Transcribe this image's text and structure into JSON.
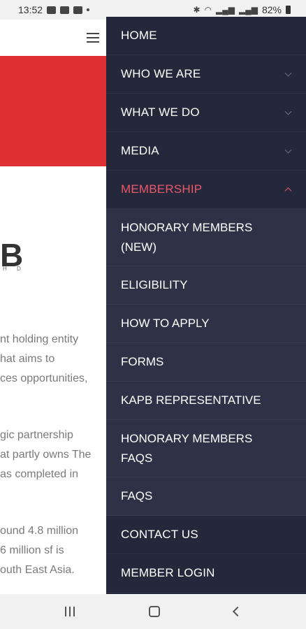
{
  "status": {
    "time": "13:52",
    "battery": "82%"
  },
  "page": {
    "logo_fragment": "B",
    "logo_sub": "H D",
    "paragraphs": [
      [
        "nt holding entity",
        "hat aims to",
        "ces opportunities,"
      ],
      [
        "gic partnership",
        "at partly owns The",
        "as completed in"
      ],
      [
        "ound 4.8 million",
        "6 million sf is",
        "outh  East Asia."
      ]
    ]
  },
  "menu": {
    "items": [
      {
        "label": "HOME",
        "chevron": "none"
      },
      {
        "label": "WHO WE ARE",
        "chevron": "down"
      },
      {
        "label": "WHAT WE  DO",
        "chevron": "down"
      },
      {
        "label": "MEDIA",
        "chevron": "down"
      },
      {
        "label": "MEMBERSHIP",
        "chevron": "up"
      }
    ],
    "submenu": [
      {
        "line1": "HONORARY  MEMBERS",
        "line2": "(NEW)"
      },
      {
        "line1": "ELIGIBILITY",
        "line2": ""
      },
      {
        "line1": "HOW TO APPLY",
        "line2": ""
      },
      {
        "line1": "FORMS",
        "line2": ""
      },
      {
        "line1": "KAPB  REPRESENTATIVE",
        "line2": ""
      },
      {
        "line1": "HONORARY  MEMBERS",
        "line2": "FAQS"
      },
      {
        "line1": "FAQS",
        "line2": ""
      }
    ],
    "after": [
      {
        "label": "CONTACT US"
      },
      {
        "label": "MEMBER  LOGIN"
      }
    ]
  },
  "colors": {
    "drawer_bg": "#25283b",
    "submenu_bg": "#2f3246",
    "active": "#e9576b",
    "banner_red": "#df3033"
  }
}
